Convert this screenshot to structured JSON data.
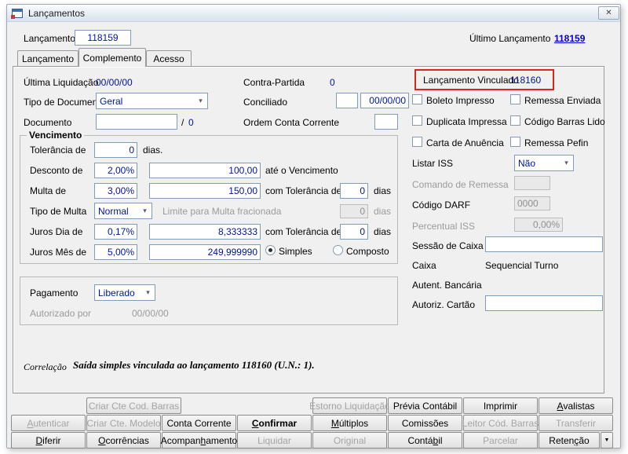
{
  "window": {
    "title": "Lançamentos"
  },
  "icons": {
    "chevron_down": "▾",
    "close": "✕",
    "dropdown_arrow": "▼"
  },
  "header": {
    "label": "Lançamento",
    "value": "118159",
    "last_label": "Último Lançamento",
    "last_value": "118159"
  },
  "tabs": [
    {
      "label": "Lançamento"
    },
    {
      "label": "Complemento"
    },
    {
      "label": "Acesso"
    }
  ],
  "info": {
    "ultima_liquidacao_label": "Última Liquidação",
    "ultima_liquidacao_value": "00/00/00",
    "contra_partida_label": "Contra-Partida",
    "contra_partida_value": "0",
    "vinculado_label": "Lançamento Vinculado",
    "vinculado_value": "118160",
    "tipo_documento_label": "Tipo de Documento",
    "tipo_documento_value": "Geral",
    "conciliado_label": "Conciliado",
    "conciliado_date": "00/00/00",
    "documento_label": "Documento",
    "documento_sep": "/",
    "documento_seq": "0",
    "ordem_label": "Ordem Conta Corrente"
  },
  "vencimento": {
    "title": "Vencimento",
    "tolerancia_label": "Tolerância de",
    "tolerancia_value": "0",
    "tolerancia_suffix": "dias.",
    "desconto_label": "Desconto de",
    "desconto_pct": "2,00%",
    "desconto_valor": "100,00",
    "desconto_suffix": "até o Vencimento",
    "multa_label": "Multa de",
    "multa_pct": "3,00%",
    "multa_valor": "150,00",
    "multa_tol_label": "com Tolerância de",
    "multa_tol_value": "0",
    "multa_dias": "dias",
    "tipo_multa_label": "Tipo de Multa",
    "tipo_multa_value": "Normal",
    "limite_label": "Limite para Multa fracionada",
    "limite_value": "0",
    "limite_dias": "dias",
    "juros_dia_label": "Juros Dia de",
    "juros_dia_pct": "0,17%",
    "juros_dia_valor": "8,333333",
    "juros_dia_tol_label": "com Tolerância de",
    "juros_dia_tol_value": "0",
    "juros_dia_dias": "dias",
    "juros_mes_label": "Juros Mês de",
    "juros_mes_pct": "5,00%",
    "juros_mes_valor": "249,999990",
    "radio_simples": "Simples",
    "radio_composto": "Composto"
  },
  "pagamento": {
    "label": "Pagamento",
    "value": "Liberado",
    "autorizado_label": "Autorizado por",
    "autorizado_value": "00/00/00"
  },
  "flags": {
    "boleto": "Boleto Impresso",
    "remessa_enviada": "Remessa Enviada",
    "duplicata": "Duplicata Impressa",
    "codigo_barras": "Código Barras Lido",
    "carta": "Carta de Anuência",
    "pefin": "Remessa Pefin"
  },
  "right": {
    "listar_iss_label": "Listar ISS",
    "listar_iss_value": "Não",
    "comando_label": "Comando de Remessa",
    "darf_label": "Código DARF",
    "darf_value": "0000",
    "percentual_label": "Percentual ISS",
    "percentual_value": "0,00%",
    "sessao_label": "Sessão de Caixa",
    "caixa_label": "Caixa",
    "caixa_value": "Sequencial Turno",
    "autent_label": "Autent. Bancária",
    "autoriz_label": "Autoriz. Cartão"
  },
  "correlacao": {
    "label": "Correlação",
    "text": "Saída simples vinculada ao lançamento 118160 (U.N.: 1)."
  },
  "buttons": {
    "criar_cte_barras": "Criar Cte Cod. Barras",
    "estorno": "Estorno Liquidação",
    "previa": "Prévia Contábil",
    "imprimir": "Imprimir",
    "avalistas": "&Avalistas",
    "autenticar": "&Autenticar",
    "criar_cte_modelo": "Criar Cte. Modelo",
    "conta_corrente": "Conta Corrente",
    "confirmar": "&Confirmar",
    "multiplos": "&Múltiplos",
    "comissoes": "Comissões",
    "leitor": "Leitor Cód. Barras",
    "transferir": "Transferir",
    "diferir": "&Diferir",
    "ocorrencias": "&Ocorrências",
    "acompanhamento": "Acompan&hamento",
    "liquidar": "Liquidar",
    "original": "Original",
    "contabil": "Contá&bil",
    "parcelar": "Parcelar",
    "retencao": "Reten&ção"
  }
}
